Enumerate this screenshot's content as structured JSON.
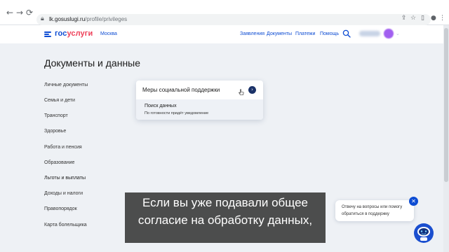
{
  "browser": {
    "url_host": "lk.gosuslugi.ru",
    "url_path": "/profile/privileges",
    "back_icon": "arrow-left-icon",
    "forward_icon": "arrow-right-icon",
    "reload_icon": "reload-icon"
  },
  "header": {
    "logo_part1": "гос",
    "logo_part2": "услуги",
    "city": "Москва",
    "menu": [
      "Заявления",
      "Документы",
      "Платежи",
      "Помощь"
    ]
  },
  "main": {
    "title": "Документы и данные",
    "sidebar": [
      "Личные документы",
      "Семья и дети",
      "Транспорт",
      "Здоровье",
      "Работа и пенсия",
      "Образование",
      "Льготы и выплаты",
      "Доходы и налоги",
      "Правопорядок",
      "Карта болельщика"
    ],
    "card": {
      "title": "Меры социальной поддержки",
      "status": "Поиск данных",
      "note": "По готовности придёт уведомление"
    }
  },
  "subtitles": {
    "line1": "Если вы уже подавали общее",
    "line2": "согласие на обработку данных,"
  },
  "chat": {
    "line1": "Отвечу на вопросы или помогу",
    "line2": "обратиться в поддержку"
  },
  "colors": {
    "brand_blue": "#0d4cd3",
    "brand_red": "#ee3f58",
    "dark_navy": "#1b3268"
  }
}
